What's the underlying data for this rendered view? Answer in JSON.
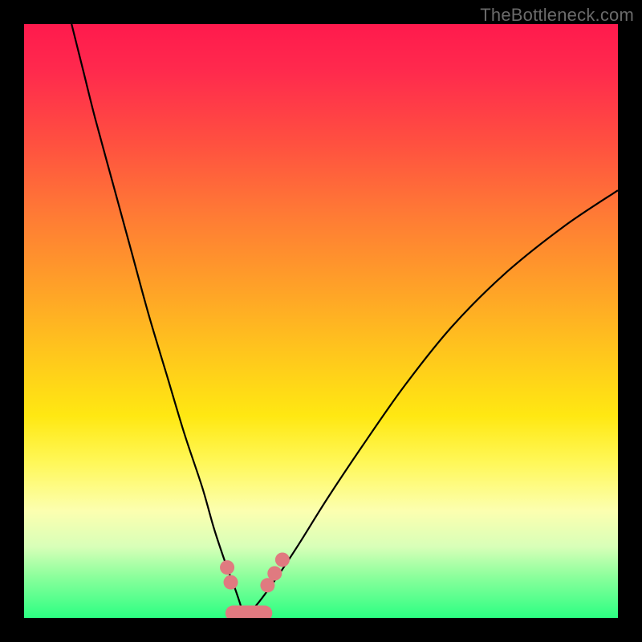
{
  "watermark": "TheBottleneck.com",
  "colors": {
    "curve": "#000000",
    "marker": "#e07a80",
    "background_black": "#000000"
  },
  "chart_data": {
    "type": "line",
    "title": "",
    "xlabel": "",
    "ylabel": "",
    "xlim": [
      0,
      100
    ],
    "ylim": [
      0,
      100
    ],
    "note": "Background gradient maps vertical position to bottleneck severity: top=red (severe), bottom=green (balanced). Two curves descend into a V shape with minimum near x≈37.",
    "series": [
      {
        "name": "left-branch",
        "x": [
          8,
          10,
          12,
          15,
          18,
          21,
          24,
          27,
          30,
          32,
          34,
          35.5,
          36.5,
          37
        ],
        "y": [
          100,
          92,
          84,
          73,
          62,
          51,
          41,
          31,
          22,
          15,
          9,
          5,
          2,
          0
        ]
      },
      {
        "name": "right-branch",
        "x": [
          37,
          39,
          42,
          46,
          51,
          57,
          64,
          72,
          81,
          91,
          100
        ],
        "y": [
          0,
          2,
          6,
          12,
          20,
          29,
          39,
          49,
          58,
          66,
          72
        ]
      }
    ],
    "markers": [
      {
        "series": "left-branch",
        "x": 34.2,
        "y": 8.5
      },
      {
        "series": "left-branch",
        "x": 34.8,
        "y": 6.0
      },
      {
        "series": "right-branch",
        "x": 41.0,
        "y": 5.5
      },
      {
        "series": "right-branch",
        "x": 42.2,
        "y": 7.5
      },
      {
        "series": "right-branch",
        "x": 43.5,
        "y": 9.8
      }
    ],
    "flat_bottom": {
      "x_start": 35.2,
      "x_end": 40.5,
      "y": 0.8,
      "thickness": 2.6
    }
  }
}
